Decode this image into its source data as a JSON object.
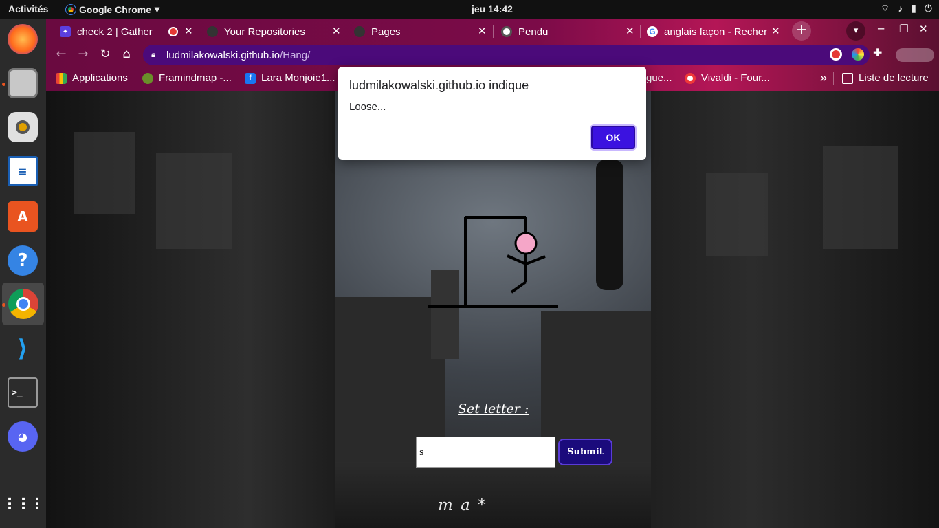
{
  "topbar": {
    "activities": "Activités",
    "app": "Google Chrome",
    "clock": "jeu 14:42",
    "app_arrow": "▾"
  },
  "tabs": [
    {
      "label": "check 2 | Gather",
      "icon": "gather-icon"
    },
    {
      "label": "Your Repositories",
      "icon": "github-icon"
    },
    {
      "label": "Pages",
      "icon": "github-icon"
    },
    {
      "label": "Pendu",
      "icon": "globe-icon"
    },
    {
      "label": "anglais façon - Recher",
      "icon": "google-icon"
    }
  ],
  "address": {
    "host": "ludmilakowalski.github.io",
    "path": "/Hang/"
  },
  "bookmarks": [
    {
      "label": "Applications"
    },
    {
      "label": "Framindmap -..."
    },
    {
      "label": "Lara Monjoie1..."
    },
    {
      "label": "gue..."
    },
    {
      "label": "Vivaldi - Four..."
    },
    {
      "label": "Liste de lecture"
    }
  ],
  "bookmarks_more": "»",
  "dialog": {
    "title": "ludmilakowalski.github.io indique",
    "message": "Loose...",
    "ok": "OK"
  },
  "game": {
    "set_letter_label": "Set letter :",
    "input_value": "s",
    "submit": "Submit",
    "word": "m a *"
  },
  "colors": {
    "accent": "#3b12e0",
    "chrome": "#7b0b48",
    "omnibox": "#4b0a7a",
    "submit": "#1b0b7c"
  }
}
